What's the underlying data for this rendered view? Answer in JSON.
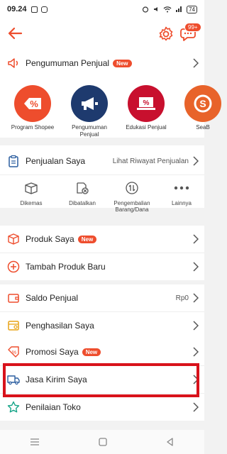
{
  "status_bar": {
    "time": "09.24",
    "battery": "74"
  },
  "app_bar": {
    "chat_badge": "99+"
  },
  "announcement": {
    "label": "Pengumuman Penjual",
    "badge": "New"
  },
  "shortcuts": [
    {
      "label": "Program Shopee",
      "icon": "percent-tag-icon",
      "color": "#ee4d2d"
    },
    {
      "label": "Pengumuman Penjual",
      "icon": "megaphone-icon",
      "color": "#1e3a6e"
    },
    {
      "label": "Edukasi Penjual",
      "icon": "laptop-percent-icon",
      "color": "#c8102e"
    },
    {
      "label": "SeaB",
      "icon": "seabank-icon",
      "color": "#e8632a"
    }
  ],
  "sales": {
    "label": "Penjualan Saya",
    "history_link": "Lihat Riwayat Penjualan",
    "statuses": [
      {
        "label": "Dikemas",
        "icon": "box-icon"
      },
      {
        "label": "Dibatalkan",
        "icon": "cancelled-icon"
      },
      {
        "label": "Pengembalian Barang/Dana",
        "icon": "return-icon"
      },
      {
        "label": "Lainnya",
        "icon": "more-icon"
      }
    ]
  },
  "products": {
    "my_products": "Produk Saya",
    "my_products_badge": "New",
    "add_product": "Tambah Produk Baru"
  },
  "finance": {
    "balance_label": "Saldo Penjual",
    "balance_value": "Rp0",
    "income_label": "Penghasilan Saya"
  },
  "menu": {
    "promotion": "Promosi Saya",
    "promotion_badge": "New",
    "shipping": "Jasa Kirim Saya",
    "shop_rating": "Penilaian Toko"
  },
  "colors": {
    "brand": "#ee4d2d",
    "highlight": "#d8121b"
  }
}
